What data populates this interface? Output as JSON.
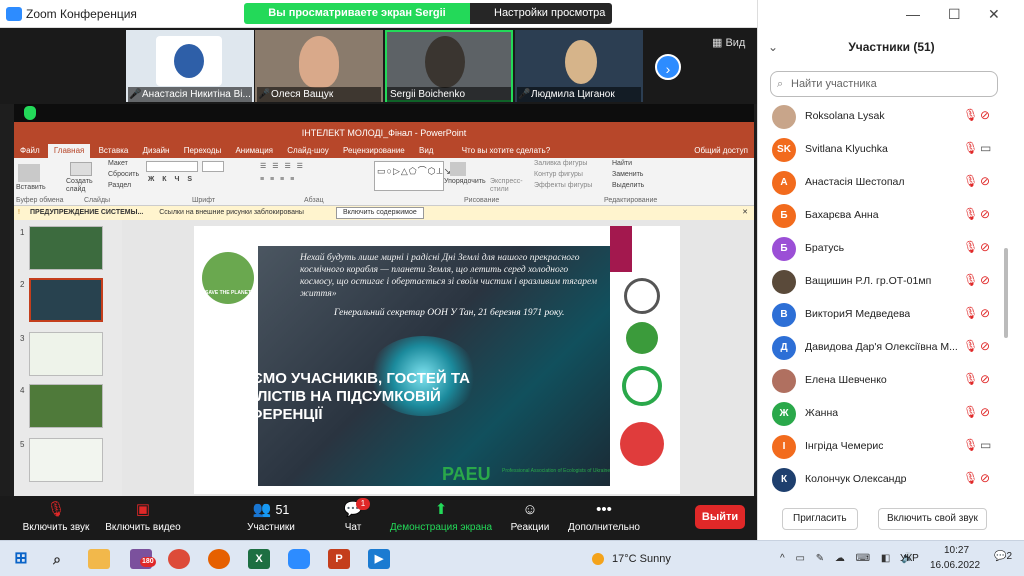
{
  "window": {
    "title": "Zoom Конференция"
  },
  "share": {
    "banner": "Вы просматриваете экран Sergii Boichenko",
    "view_options": "Настройки просмотра ⌄"
  },
  "thumbs": [
    {
      "name": "Анастасія Никитіна Ві..."
    },
    {
      "name": "Олеся Ващук"
    },
    {
      "name": "Sergii Boichenko"
    },
    {
      "name": "Людмила Циганок"
    }
  ],
  "view_label": "Вид",
  "ppt": {
    "title": "ІНТЕЛЕКТ МОЛОДІ_Фінал - PowerPoint",
    "tabs": [
      "Файл",
      "Главная",
      "Вставка",
      "Дизайн",
      "Переходы",
      "Анимация",
      "Слайд-шоу",
      "Рецензирование",
      "Вид",
      "Что вы хотите сделать?",
      "Общий доступ"
    ],
    "ribbon": {
      "paste": "Вставить",
      "create_slide": "Создать слайд",
      "layout": "Макет",
      "reset": "Сбросить",
      "section": "Раздел",
      "arrange": "Упорядочить",
      "quick_styles": "Экспресс-стили",
      "fill": "Заливка фигуры",
      "outline": "Контур фигуры",
      "effects": "Эффекты фигуры",
      "find": "Найти",
      "replace": "Заменить",
      "select": "Выделить",
      "groups": [
        "Буфер обмена",
        "Слайды",
        "Шрифт",
        "Абзац",
        "Рисование",
        "Редактирование"
      ]
    },
    "warning": {
      "label": "ПРЕДУПРЕЖДЕНИЕ СИСТЕМЫ...",
      "text": "Ссылки на внешние рисунки заблокированы",
      "button": "Включить содержимое"
    },
    "slide_numbers": [
      "1",
      "2",
      "3",
      "4",
      "5"
    ],
    "slide": {
      "quote": "Нехай будуть лише мирні і радісні Дні Землі для нашого прекрасного космічного корабля — планети Земля, що летить серед холодного космосу, що остигає і обертається зі своїм чистим і вразливим тягарем життя»",
      "signature": "Генеральний секретар ООН У Тан, 21 березня 1971 року.",
      "headline": "ВІТАЄМО УЧАСНИКІВ, ГОСТЕЙ ТА ФІНАЛІСТІВ НА ПІДСУМКОВІЙ КОНФЕРЕНЦІЇ",
      "save_planet": "SAVE THE PLANET",
      "paeu": "PAEU",
      "paeu_sub": "Professional Association of Ecologists of Ukraine"
    }
  },
  "toolbar": {
    "unmute": "Включить звук",
    "video": "Включить видео",
    "participants": "Участники",
    "participants_count": "51",
    "chat": "Чат",
    "chat_badge": "1",
    "share": "Демонстрация экрана",
    "reactions": "Реакции",
    "more": "Дополнительно",
    "leave": "Выйти"
  },
  "panel": {
    "title": "Участники (51)",
    "search_placeholder": "Найти участника",
    "participants": [
      {
        "initials": "",
        "name": "Roksolana Lysak",
        "color": "#c8a58a",
        "video": "off"
      },
      {
        "initials": "SK",
        "name": "Svitlana Klyuchka",
        "color": "#f26b1d",
        "video": "on"
      },
      {
        "initials": "А",
        "name": "Анастасія Шестопал",
        "color": "#f26b1d",
        "video": "off"
      },
      {
        "initials": "Б",
        "name": "Бахарєва Анна",
        "color": "#f26b1d",
        "video": "off"
      },
      {
        "initials": "Б",
        "name": "Братусь",
        "color": "#9b4fd6",
        "video": "off"
      },
      {
        "initials": "",
        "name": "Ващишин Р.Л. гр.ОТ-01мп",
        "color": "#5a4a3a",
        "video": "off"
      },
      {
        "initials": "В",
        "name": "ВикториЯ Медведева",
        "color": "#2d6fd6",
        "video": "off"
      },
      {
        "initials": "Д",
        "name": "Давидова Дар'я Олексіївна М...",
        "color": "#2d6fd6",
        "video": "off"
      },
      {
        "initials": "",
        "name": "Елена Шевченко",
        "color": "#b07060",
        "video": "off"
      },
      {
        "initials": "Ж",
        "name": "Жанна",
        "color": "#2aa84a",
        "video": "off"
      },
      {
        "initials": "І",
        "name": "Інгріда Чемерис",
        "color": "#f26b1d",
        "video": "on"
      },
      {
        "initials": "К",
        "name": "Колончук Олександр",
        "color": "#1e3f6e",
        "video": "off"
      }
    ],
    "invite": "Пригласить",
    "unmute_self": "Включить свой звук"
  },
  "taskbar": {
    "weather": "17°C  Sunny",
    "lang": "УКР",
    "time": "10:27",
    "date": "16.06.2022",
    "notif": "2",
    "viber_badge": "180"
  }
}
